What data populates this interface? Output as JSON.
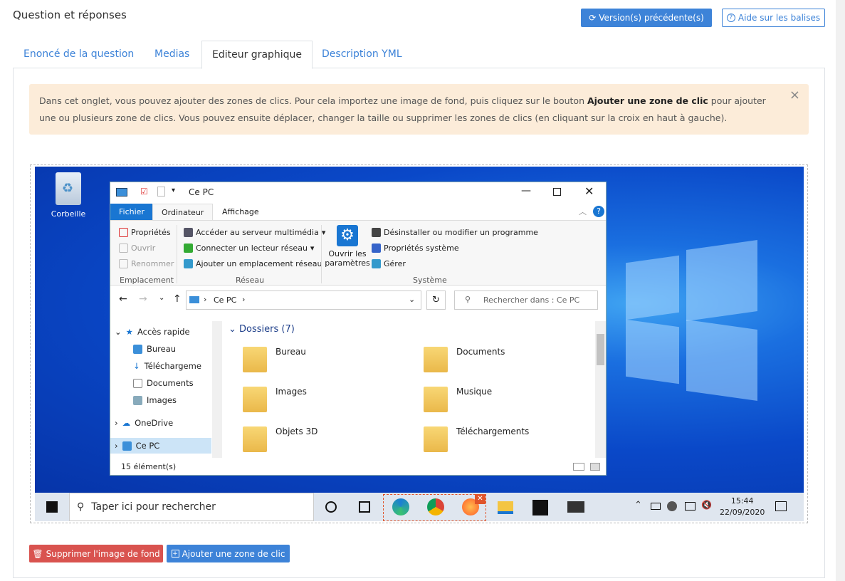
{
  "header": {
    "title": "Question et réponses",
    "version_button": "Version(s) précédente(s)",
    "help_button": "Aide sur les balises"
  },
  "tabs": [
    "Enoncé de la question",
    "Medias",
    "Editeur graphique",
    "Description YML"
  ],
  "active_tab": "Editeur graphique",
  "alert": {
    "text_before": "Dans cet onglet, vous pouvez ajouter des zones de clics. Pour cela importez une image de fond, puis cliquez sur le bouton ",
    "bold": "Ajouter une zone de clic",
    "text_after": " pour ajouter une ou plusieurs zone de clics. Vous pouvez ensuite déplacer, changer la taille ou supprimer les zones de clics (en cliquant sur la croix en haut à gauche).",
    "close": "×"
  },
  "desktop": {
    "recycle_bin": "Corbeille"
  },
  "explorer": {
    "title": "Ce PC",
    "ribbon_tabs": [
      "Fichier",
      "Ordinateur",
      "Affichage"
    ],
    "ribbon": {
      "emplacement": [
        "Propriétés",
        "Ouvrir",
        "Renommer"
      ],
      "emplacement_label": "Emplacement",
      "reseau": [
        "Accéder au serveur multimédia",
        "Connecter un lecteur réseau",
        "Ajouter un emplacement réseau"
      ],
      "reseau_label": "Réseau",
      "settings_line1": "Ouvrir les",
      "settings_line2": "paramètres",
      "systeme": [
        "Désinstaller ou modifier un programme",
        "Propriétés système",
        "Gérer"
      ],
      "systeme_label": "Système"
    },
    "address": "Ce PC",
    "search_placeholder": "Rechercher dans : Ce PC",
    "nav": [
      "Accès rapide",
      "Bureau",
      "Téléchargeme",
      "Documents",
      "Images",
      "OneDrive",
      "Ce PC"
    ],
    "folders_header": "Dossiers (7)",
    "folders": [
      "Bureau",
      "Documents",
      "Images",
      "Musique",
      "Objets 3D",
      "Téléchargements"
    ],
    "status": "15 élément(s)"
  },
  "taskbar": {
    "search_placeholder": "Taper ici pour rechercher",
    "time": "15:44",
    "date": "22/09/2020"
  },
  "actions": {
    "delete_background": "Supprimer l'image de fond",
    "add_zone": "Ajouter une zone de clic"
  },
  "colors": {
    "primary": "#3d83d8",
    "danger": "#d9534f",
    "alert_bg": "#fcecd9",
    "click_zone": "#e0542a"
  }
}
